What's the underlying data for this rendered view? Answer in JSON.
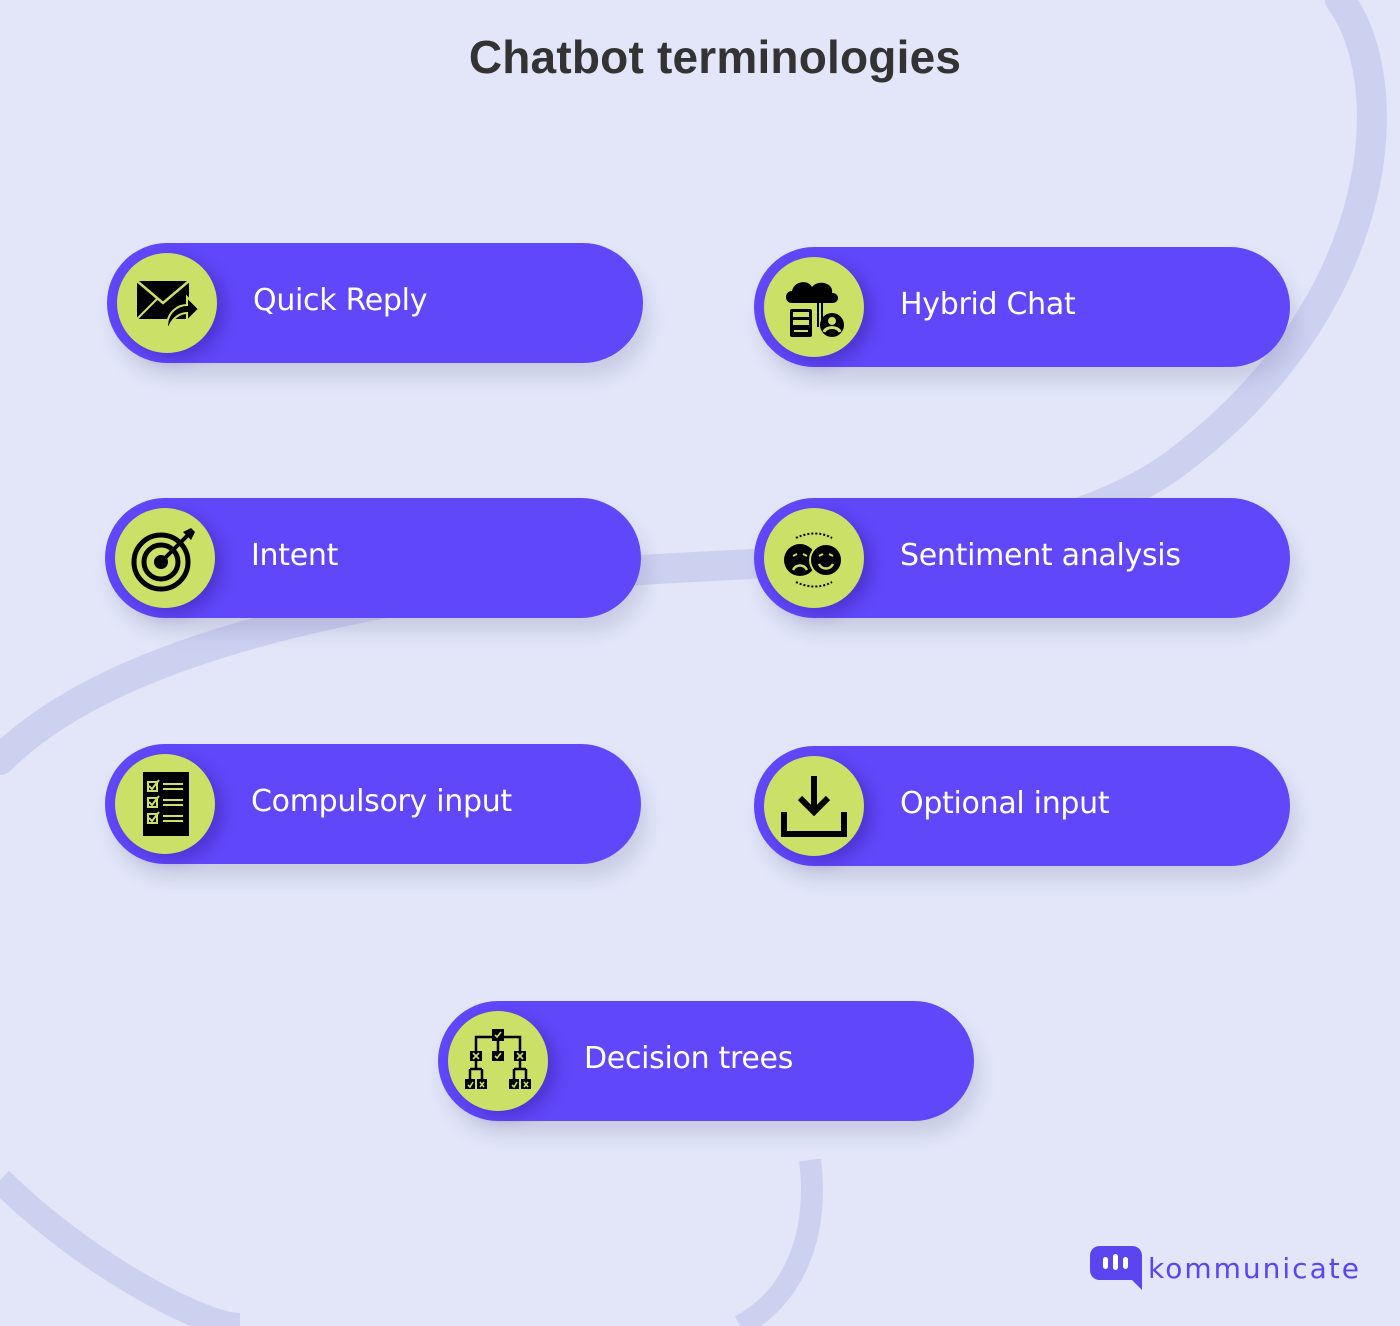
{
  "title": "Chatbot terminologies",
  "colors": {
    "background": "#e2e6f8",
    "pill": "#6047f9",
    "badge": "#cbe066",
    "icon": "#000000",
    "label": "#ffffff",
    "title": "#333333",
    "brand": "#5a45f0"
  },
  "terms": [
    {
      "label": "Quick Reply",
      "icon": "mail-reply-icon"
    },
    {
      "label": "Hybrid Chat",
      "icon": "cloud-server-user-icon"
    },
    {
      "label": "Intent",
      "icon": "target-dart-icon"
    },
    {
      "label": "Sentiment analysis",
      "icon": "sad-happy-faces-icon"
    },
    {
      "label": "Compulsory input",
      "icon": "checklist-icon"
    },
    {
      "label": "Optional input",
      "icon": "download-tray-icon"
    },
    {
      "label": "Decision trees",
      "icon": "decision-tree-icon"
    }
  ],
  "logo": {
    "brand": "kommunicate",
    "icon": "chat-bubble-bars-icon"
  }
}
